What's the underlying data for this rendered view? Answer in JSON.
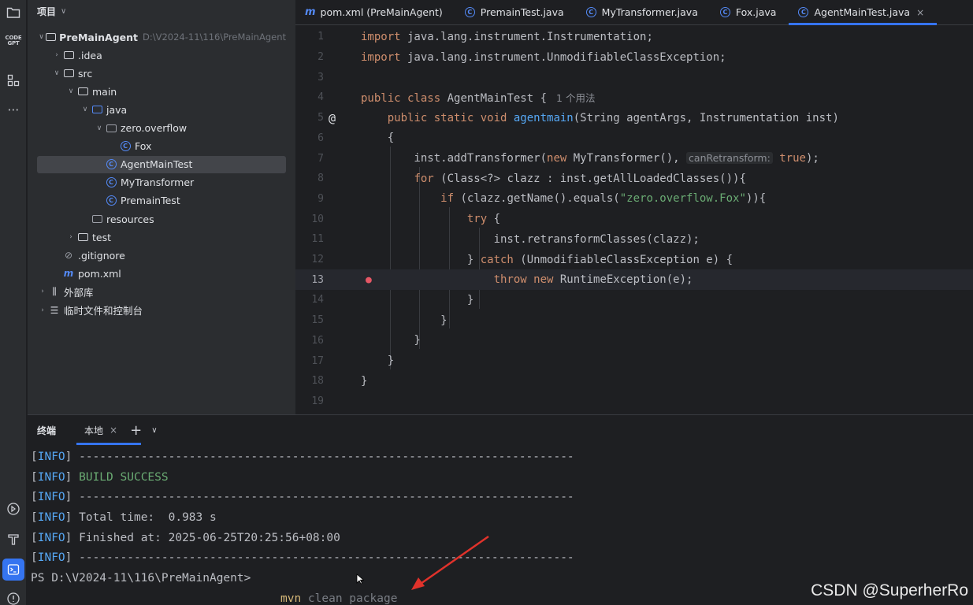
{
  "toolstrip": {
    "items": [
      {
        "name": "project-tool",
        "glyph": "▭"
      },
      {
        "name": "codegpt-tool",
        "glyph": "CODE GPT"
      },
      {
        "name": "structure-tool",
        "glyph": "⊞"
      },
      {
        "name": "more-tool",
        "glyph": "⋯"
      }
    ],
    "bottom": [
      {
        "name": "services-tool",
        "glyph": "▷"
      },
      {
        "name": "build-tool",
        "glyph": "⊤"
      },
      {
        "name": "terminal-tool",
        "glyph": ">_"
      },
      {
        "name": "problems-tool",
        "glyph": "!"
      }
    ]
  },
  "project": {
    "title": "项目",
    "tree": [
      {
        "label": "PreMainAgent",
        "hint": "D:\\V2024-11\\116\\PreMainAgent",
        "arrow": "∨",
        "icon": "module",
        "depth": 0
      },
      {
        "label": ".idea",
        "arrow": "›",
        "icon": "folder",
        "depth": 1
      },
      {
        "label": "src",
        "arrow": "∨",
        "icon": "folder",
        "depth": 1
      },
      {
        "label": "main",
        "arrow": "∨",
        "icon": "folder",
        "depth": 2
      },
      {
        "label": "java",
        "arrow": "∨",
        "icon": "folder-blue",
        "depth": 3
      },
      {
        "label": "zero.overflow",
        "arrow": "∨",
        "icon": "package",
        "depth": 4
      },
      {
        "label": "Fox",
        "arrow": "",
        "icon": "class",
        "depth": 5
      },
      {
        "label": "AgentMainTest",
        "arrow": "",
        "icon": "class",
        "depth": 4,
        "selected": true
      },
      {
        "label": "MyTransformer",
        "arrow": "",
        "icon": "class",
        "depth": 4
      },
      {
        "label": "PremainTest",
        "arrow": "",
        "icon": "class",
        "depth": 4
      },
      {
        "label": "resources",
        "arrow": "",
        "icon": "resources",
        "depth": 3
      },
      {
        "label": "test",
        "arrow": "›",
        "icon": "folder",
        "depth": 2
      },
      {
        "label": ".gitignore",
        "arrow": "",
        "icon": "ignore",
        "depth": 1
      },
      {
        "label": "pom.xml",
        "arrow": "",
        "icon": "maven",
        "depth": 1
      },
      {
        "label": "外部库",
        "arrow": "›",
        "icon": "library",
        "depth": 0
      },
      {
        "label": "临时文件和控制台",
        "arrow": "›",
        "icon": "scratch",
        "depth": 0
      }
    ]
  },
  "tabs": [
    {
      "label": "pom.xml (PreMainAgent)",
      "icon": "maven"
    },
    {
      "label": "PremainTest.java",
      "icon": "class"
    },
    {
      "label": "MyTransformer.java",
      "icon": "class"
    },
    {
      "label": "Fox.java",
      "icon": "class"
    },
    {
      "label": "AgentMainTest.java",
      "icon": "class",
      "active": true,
      "close": "×"
    }
  ],
  "editor": {
    "line_numbers": [
      "1",
      "2",
      "3",
      "4",
      "5",
      "6",
      "7",
      "8",
      "9",
      "10",
      "11",
      "12",
      "13",
      "14",
      "15",
      "16",
      "17",
      "18",
      "19"
    ],
    "current_line": 13,
    "usage_hint": "1 个用法",
    "param_hint": "canRetransform:"
  },
  "terminal": {
    "title": "终端",
    "tab_label": "本地",
    "tab_close": "×",
    "lines": [
      {
        "tag": "INFO",
        "text": " ------------------------------------------------------------------------",
        "kind": "plain"
      },
      {
        "tag": "INFO",
        "text": " BUILD SUCCESS",
        "kind": "success"
      },
      {
        "tag": "INFO",
        "text": " ------------------------------------------------------------------------",
        "kind": "plain"
      },
      {
        "tag": "INFO",
        "text": " Total time:  0.983 s",
        "kind": "plain"
      },
      {
        "tag": "INFO",
        "text": " Finished at: 2025-06-25T20:25:56+08:00",
        "kind": "plain"
      },
      {
        "tag": "INFO",
        "text": " ------------------------------------------------------------------------",
        "kind": "plain"
      }
    ],
    "prompt": "PS D:\\V2024-11\\116\\PreMainAgent>",
    "suggestion_cmd": "mvn",
    "suggestion_args": " clean package"
  },
  "watermark": "CSDN @SuperherRo",
  "colors": {
    "accent": "#3574f0",
    "keyword": "#cf8e6d",
    "function": "#56a8f5",
    "string": "#6aab73",
    "arrow": "#e0322b"
  }
}
